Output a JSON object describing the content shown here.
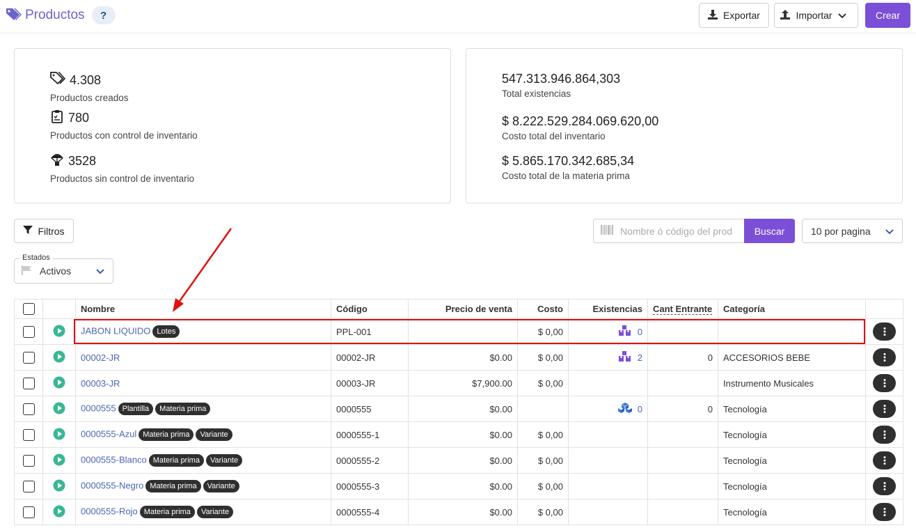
{
  "header": {
    "title": "Productos",
    "help_label": "?",
    "export_label": "Exportar",
    "import_label": "Importar",
    "create_label": "Crear"
  },
  "summary_left": [
    {
      "value": "4.308",
      "label": "Productos creados",
      "icon": "tags-icon"
    },
    {
      "value": "780",
      "label": "Productos con control de inventario",
      "icon": "clipboard-icon"
    },
    {
      "value": "3528",
      "label": "Productos sin control de inventario",
      "icon": "parachute-icon"
    }
  ],
  "summary_right": [
    {
      "value": "547.313.946.864,303",
      "label": "Total existencias"
    },
    {
      "value": "$ 8.222.529.284.069.620,00",
      "label": "Costo total del inventario"
    },
    {
      "value": "$ 5.865.170.342.685,34",
      "label": "Costo total de la materia prima"
    }
  ],
  "toolbar": {
    "filters_label": "Filtros",
    "search_placeholder": "Nombre ó código del prod",
    "search_button": "Buscar",
    "per_page": "10 por pagina",
    "estados_legend": "Estados",
    "estados_value": "Activos"
  },
  "table": {
    "columns": [
      "Nombre",
      "Código",
      "Precio de venta",
      "Costo",
      "Existencias",
      "Cant Entrante",
      "Categoría"
    ],
    "rows": [
      {
        "name": "JABON LIQUIDO",
        "tags": [
          "Lotes"
        ],
        "code": "PPL-001",
        "price": "",
        "cost": "$ 0,00",
        "stock": "0",
        "stock_icon": "boxes-icon",
        "incoming": "",
        "category": ""
      },
      {
        "name": "00002-JR",
        "tags": [],
        "code": "00002-JR",
        "price": "$0.00",
        "cost": "$ 0,00",
        "stock": "2",
        "stock_icon": "boxes-icon",
        "incoming": "0",
        "category": "ACCESORIOS BEBE"
      },
      {
        "name": "00003-JR",
        "tags": [],
        "code": "00003-JR",
        "price": "$7,900.00",
        "cost": "$ 0,00",
        "stock": "",
        "stock_icon": "",
        "incoming": "",
        "category": "Instrumento Musicales"
      },
      {
        "name": "0000555",
        "tags": [
          "Plantilla",
          "Materia prima"
        ],
        "code": "0000555",
        "price": "$0.00",
        "cost": "",
        "stock": "0",
        "stock_icon": "cubes-icon",
        "incoming": "0",
        "category": "Tecnología"
      },
      {
        "name": "0000555-Azul",
        "tags": [
          "Materia prima",
          "Variante"
        ],
        "code": "0000555-1",
        "price": "$0.00",
        "cost": "$ 0,00",
        "stock": "",
        "stock_icon": "",
        "incoming": "",
        "category": "Tecnología"
      },
      {
        "name": "0000555-Blanco",
        "tags": [
          "Materia prima",
          "Variante"
        ],
        "code": "0000555-2",
        "price": "$0.00",
        "cost": "$ 0,00",
        "stock": "",
        "stock_icon": "",
        "incoming": "",
        "category": "Tecnología"
      },
      {
        "name": "0000555-Negro",
        "tags": [
          "Materia prima",
          "Variante"
        ],
        "code": "0000555-3",
        "price": "$0.00",
        "cost": "$ 0,00",
        "stock": "",
        "stock_icon": "",
        "incoming": "",
        "category": "Tecnología"
      },
      {
        "name": "0000555-Rojo",
        "tags": [
          "Materia prima",
          "Variante"
        ],
        "code": "0000555-4",
        "price": "$0.00",
        "cost": "$ 0,00",
        "stock": "",
        "stock_icon": "",
        "incoming": "",
        "category": "Tecnología"
      }
    ]
  },
  "colors": {
    "accent": "#7b4fd6",
    "link": "#4a67b6",
    "tag_bg": "#2f2f2f",
    "play_green": "#3ab795",
    "annotation_red": "#e01010"
  }
}
